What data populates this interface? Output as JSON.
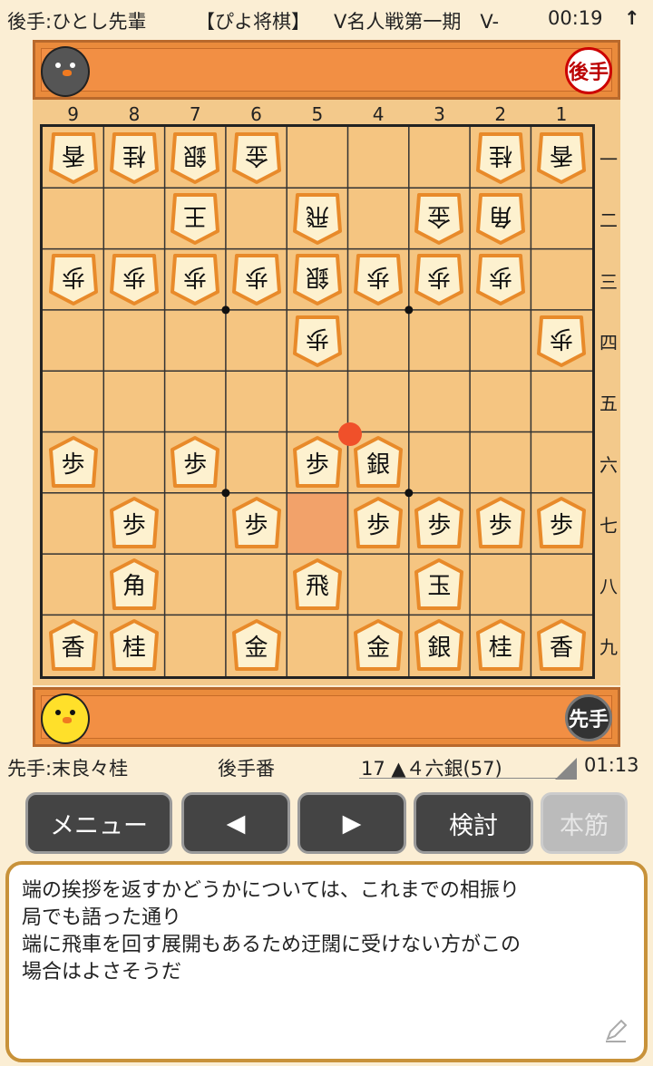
{
  "header": {
    "opponent": "後手:ひとし先輩",
    "app_name": "【ぴよ将棋】",
    "event": "V名人戦第一期　V-",
    "gote_time": "00:19",
    "up_arrow": "↑"
  },
  "gote_hand": {
    "badge": "後手",
    "avatar_icon": "gray-bird-icon"
  },
  "sente_hand": {
    "badge": "先手",
    "avatar_icon": "yellow-chick-icon"
  },
  "board": {
    "file_labels": [
      "9",
      "8",
      "7",
      "6",
      "5",
      "4",
      "3",
      "2",
      "1"
    ],
    "rank_labels": [
      "一",
      "二",
      "三",
      "四",
      "五",
      "六",
      "七",
      "八",
      "九"
    ],
    "highlight_square": {
      "file": 5,
      "rank": 7
    },
    "last_move_square": {
      "file": 4,
      "rank": 6
    },
    "pieces": [
      {
        "file": 9,
        "rank": 1,
        "kanji": "香",
        "owner": "gote"
      },
      {
        "file": 8,
        "rank": 1,
        "kanji": "桂",
        "owner": "gote"
      },
      {
        "file": 7,
        "rank": 1,
        "kanji": "銀",
        "owner": "gote"
      },
      {
        "file": 6,
        "rank": 1,
        "kanji": "金",
        "owner": "gote"
      },
      {
        "file": 2,
        "rank": 1,
        "kanji": "桂",
        "owner": "gote"
      },
      {
        "file": 1,
        "rank": 1,
        "kanji": "香",
        "owner": "gote"
      },
      {
        "file": 7,
        "rank": 2,
        "kanji": "王",
        "owner": "gote"
      },
      {
        "file": 5,
        "rank": 2,
        "kanji": "飛",
        "owner": "gote"
      },
      {
        "file": 3,
        "rank": 2,
        "kanji": "金",
        "owner": "gote"
      },
      {
        "file": 2,
        "rank": 2,
        "kanji": "角",
        "owner": "gote"
      },
      {
        "file": 9,
        "rank": 3,
        "kanji": "歩",
        "owner": "gote"
      },
      {
        "file": 8,
        "rank": 3,
        "kanji": "歩",
        "owner": "gote"
      },
      {
        "file": 7,
        "rank": 3,
        "kanji": "歩",
        "owner": "gote"
      },
      {
        "file": 6,
        "rank": 3,
        "kanji": "歩",
        "owner": "gote"
      },
      {
        "file": 5,
        "rank": 3,
        "kanji": "銀",
        "owner": "gote"
      },
      {
        "file": 4,
        "rank": 3,
        "kanji": "歩",
        "owner": "gote"
      },
      {
        "file": 3,
        "rank": 3,
        "kanji": "歩",
        "owner": "gote"
      },
      {
        "file": 2,
        "rank": 3,
        "kanji": "歩",
        "owner": "gote"
      },
      {
        "file": 5,
        "rank": 4,
        "kanji": "歩",
        "owner": "gote"
      },
      {
        "file": 1,
        "rank": 4,
        "kanji": "歩",
        "owner": "gote"
      },
      {
        "file": 9,
        "rank": 6,
        "kanji": "歩",
        "owner": "sente"
      },
      {
        "file": 7,
        "rank": 6,
        "kanji": "歩",
        "owner": "sente"
      },
      {
        "file": 5,
        "rank": 6,
        "kanji": "歩",
        "owner": "sente"
      },
      {
        "file": 4,
        "rank": 6,
        "kanji": "銀",
        "owner": "sente"
      },
      {
        "file": 8,
        "rank": 7,
        "kanji": "歩",
        "owner": "sente"
      },
      {
        "file": 6,
        "rank": 7,
        "kanji": "歩",
        "owner": "sente"
      },
      {
        "file": 4,
        "rank": 7,
        "kanji": "歩",
        "owner": "sente"
      },
      {
        "file": 3,
        "rank": 7,
        "kanji": "歩",
        "owner": "sente"
      },
      {
        "file": 2,
        "rank": 7,
        "kanji": "歩",
        "owner": "sente"
      },
      {
        "file": 1,
        "rank": 7,
        "kanji": "歩",
        "owner": "sente"
      },
      {
        "file": 8,
        "rank": 8,
        "kanji": "角",
        "owner": "sente"
      },
      {
        "file": 5,
        "rank": 8,
        "kanji": "飛",
        "owner": "sente"
      },
      {
        "file": 3,
        "rank": 8,
        "kanji": "玉",
        "owner": "sente"
      },
      {
        "file": 9,
        "rank": 9,
        "kanji": "香",
        "owner": "sente"
      },
      {
        "file": 8,
        "rank": 9,
        "kanji": "桂",
        "owner": "sente"
      },
      {
        "file": 6,
        "rank": 9,
        "kanji": "金",
        "owner": "sente"
      },
      {
        "file": 4,
        "rank": 9,
        "kanji": "金",
        "owner": "sente"
      },
      {
        "file": 3,
        "rank": 9,
        "kanji": "銀",
        "owner": "sente"
      },
      {
        "file": 2,
        "rank": 9,
        "kanji": "桂",
        "owner": "sente"
      },
      {
        "file": 1,
        "rank": 9,
        "kanji": "香",
        "owner": "sente"
      }
    ]
  },
  "status": {
    "sente_player": "先手:末良々桂",
    "turn": "後手番",
    "move": "17 ▲４六銀(57)",
    "sente_time": "01:13"
  },
  "buttons": {
    "menu": "メニュー",
    "prev": "◀",
    "next": "▶",
    "analyze": "検討",
    "mainline": "本筋"
  },
  "comment": {
    "lines": [
      "端の挨拶を返すかどうかについては、これまでの相振り",
      "局でも語った通り",
      "端に飛車を回す展開もあるため迂闊に受けない方がこの",
      "場合はよさそうだ"
    ],
    "edit_icon": "pencil-icon"
  },
  "colors": {
    "board": "#f5c581",
    "hand_bar": "#f28f44",
    "highlight": "#f2a26a",
    "last_move_dot": "#f0502a",
    "piece_face": "#fdf1cf",
    "piece_border": "#e88a2a"
  }
}
